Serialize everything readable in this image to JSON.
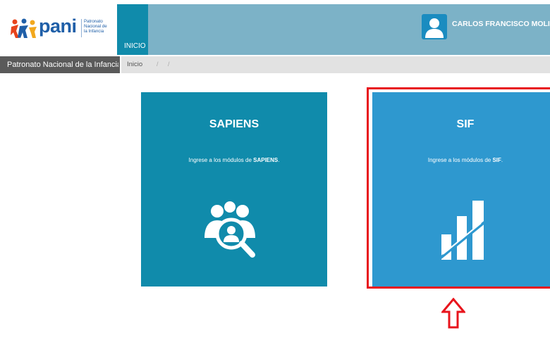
{
  "header": {
    "logo": {
      "word": "pani",
      "sub_lines": [
        "Patronato",
        "Nacional de",
        "la Infancia"
      ]
    },
    "nav_tab": "INICIO",
    "user_name": "CARLOS FRANCISCO MOLINA"
  },
  "subbar": {
    "org_name": "Patronato Nacional de la Infancia",
    "breadcrumb": [
      "Inicio",
      "/",
      "/"
    ]
  },
  "cards": [
    {
      "title": "SAPIENS",
      "desc_prefix": "Ingrese a los módulos de ",
      "desc_bold": "SAPIENS",
      "desc_suffix": ".",
      "icon": "people-search-icon",
      "color": "#108bab"
    },
    {
      "title": "SIF",
      "desc_prefix": "Ingrese a los módulos de ",
      "desc_bold": "SIF",
      "desc_suffix": ".",
      "icon": "bar-chart-icon",
      "color": "#2e98cf"
    }
  ],
  "annotation": {
    "highlight_color": "#e8141c",
    "arrow_icon": "up-arrow-icon"
  }
}
